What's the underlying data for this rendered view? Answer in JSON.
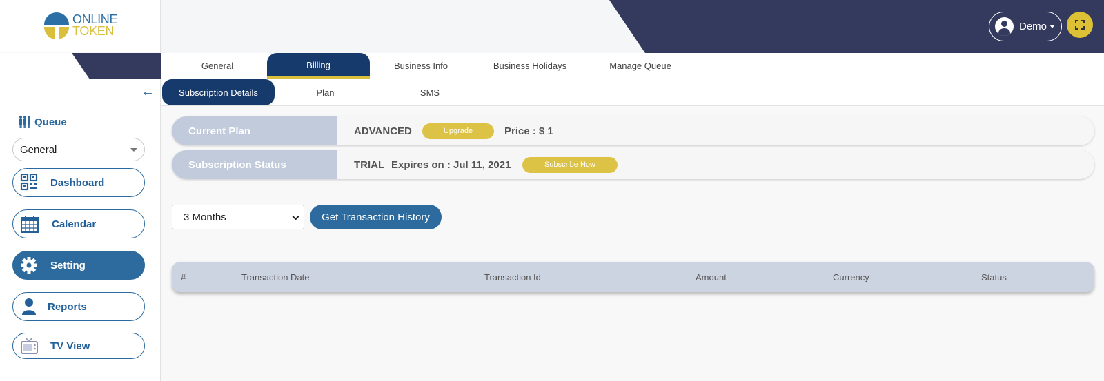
{
  "brand": {
    "line1": "ONLINE",
    "line2": "TOKEN"
  },
  "colors": {
    "navy": "#333a5e",
    "tab_active": "#173a6c",
    "accent_blue": "#2d6b9f",
    "accent_yellow": "#dcc346",
    "label_bg": "#c1cbdc"
  },
  "user": {
    "name": "Demo"
  },
  "sidebar": {
    "queue_label": "Queue",
    "queue_selected": "General",
    "nav": [
      {
        "label": "Dashboard",
        "icon": "qr-code-icon"
      },
      {
        "label": "Calendar",
        "icon": "calendar-icon"
      },
      {
        "label": "Setting",
        "icon": "gear-icon",
        "active": true
      },
      {
        "label": "Reports",
        "icon": "user-icon"
      },
      {
        "label": "TV View",
        "icon": "tv-icon"
      }
    ]
  },
  "tabs": [
    "General",
    "Billing",
    "Business Info",
    "Business Holidays",
    "Manage Queue"
  ],
  "active_tab": "Billing",
  "subtabs": [
    "Subscription Details",
    "Plan",
    "SMS"
  ],
  "active_subtab": "Subscription Details",
  "current_plan": {
    "label": "Current Plan",
    "plan": "ADVANCED",
    "upgrade_label": "Upgrade",
    "price": "Price : $ 1"
  },
  "subscription_status": {
    "label": "Subscription Status",
    "status": "TRIAL",
    "expires": "Expires on : Jul 11, 2021",
    "subscribe_label": "Subscribe Now"
  },
  "history": {
    "range_selected": "3 Months",
    "button_label": "Get Transaction History"
  },
  "table": {
    "columns": [
      "#",
      "Transaction Date",
      "Transaction Id",
      "Amount",
      "Currency",
      "Status"
    ]
  }
}
